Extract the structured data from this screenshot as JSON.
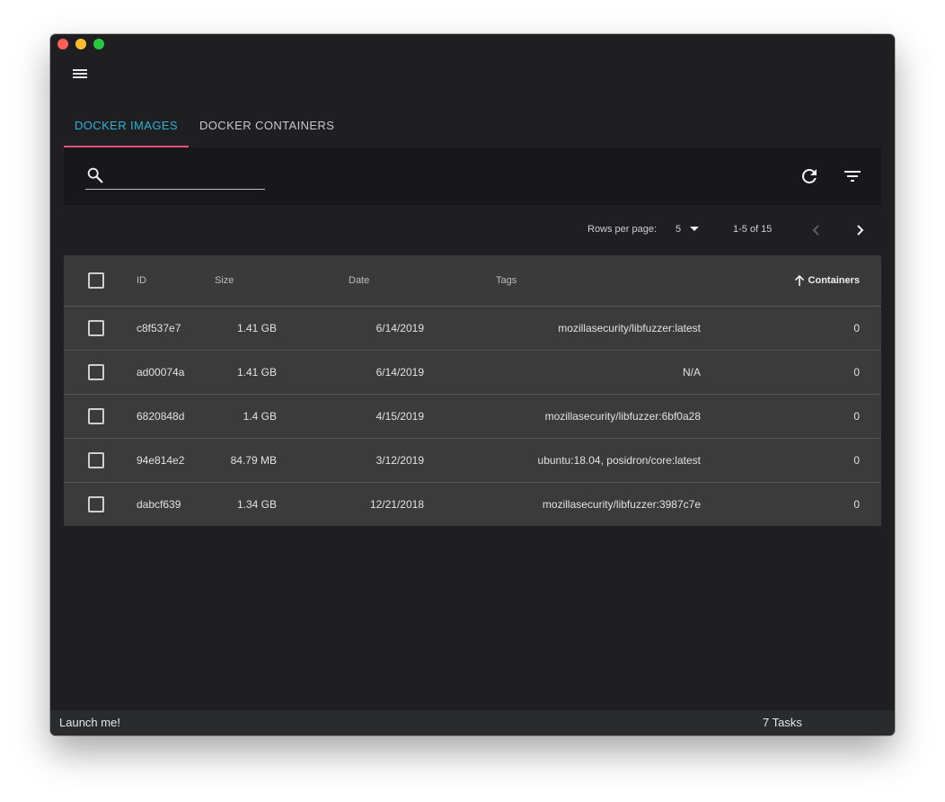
{
  "tabs": [
    {
      "label": "DOCKER IMAGES"
    },
    {
      "label": "DOCKER CONTAINERS"
    }
  ],
  "search": {
    "value": "",
    "placeholder": ""
  },
  "pagination": {
    "rows_label": "Rows per page:",
    "rows_value": "5",
    "range": "1-5 of 15"
  },
  "table": {
    "headers": {
      "id": "ID",
      "size": "Size",
      "date": "Date",
      "tags": "Tags",
      "containers": "Containers"
    },
    "rows": [
      {
        "id": "c8f537e7",
        "size": "1.41 GB",
        "date": "6/14/2019",
        "tags": "mozillasecurity/libfuzzer:latest",
        "containers": "0"
      },
      {
        "id": "ad00074a",
        "size": "1.41 GB",
        "date": "6/14/2019",
        "tags": "N/A",
        "containers": "0"
      },
      {
        "id": "6820848d",
        "size": "1.4 GB",
        "date": "4/15/2019",
        "tags": "mozillasecurity/libfuzzer:6bf0a28",
        "containers": "0"
      },
      {
        "id": "94e814e2",
        "size": "84.79 MB",
        "date": "3/12/2019",
        "tags": "ubuntu:18.04, posidron/core:latest",
        "containers": "0"
      },
      {
        "id": "dabcf639",
        "size": "1.34 GB",
        "date": "12/21/2018",
        "tags": "mozillasecurity/libfuzzer:3987c7e",
        "containers": "0"
      }
    ]
  },
  "status": {
    "launch": "Launch me!",
    "tasks": "7 Tasks"
  },
  "colors": {
    "accent_tab": "#2bb3d4",
    "tab_indicator": "#ef4f7c",
    "window_bg": "#1f1f21"
  },
  "icons": [
    "menu-icon",
    "search-icon",
    "refresh-icon",
    "filter-icon",
    "chevron-left-icon",
    "chevron-right-icon",
    "caret-down-icon",
    "arrow-up-icon"
  ]
}
